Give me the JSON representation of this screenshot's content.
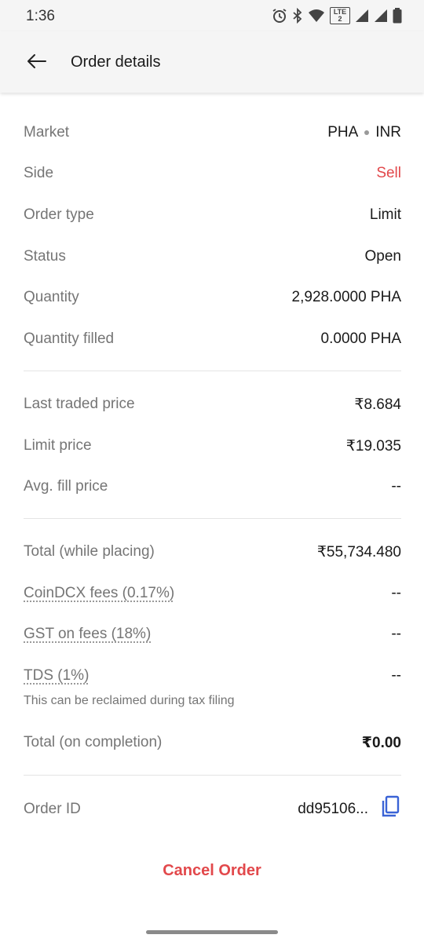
{
  "status_bar": {
    "time": "1:36",
    "network_badge": "LTE 2"
  },
  "header": {
    "title": "Order details"
  },
  "details": {
    "market_label": "Market",
    "market_base": "PHA",
    "market_quote": "INR",
    "side_label": "Side",
    "side_value": "Sell",
    "order_type_label": "Order type",
    "order_type_value": "Limit",
    "status_label": "Status",
    "status_value": "Open",
    "quantity_label": "Quantity",
    "quantity_value": "2,928.0000 PHA",
    "quantity_filled_label": "Quantity filled",
    "quantity_filled_value": "0.0000 PHA"
  },
  "prices": {
    "last_traded_label": "Last traded price",
    "last_traded_value": "₹8.684",
    "limit_label": "Limit price",
    "limit_value": "₹19.035",
    "avg_fill_label": "Avg. fill price",
    "avg_fill_value": "--"
  },
  "totals": {
    "total_placing_label": "Total (while placing)",
    "total_placing_value": "₹55,734.480",
    "fees_label": "CoinDCX fees (0.17%)",
    "fees_value": "--",
    "gst_label": "GST on fees (18%)",
    "gst_value": "--",
    "tds_label": "TDS (1%)",
    "tds_value": "--",
    "tds_note": "This can be reclaimed during tax filing",
    "total_completion_label": "Total (on completion)",
    "total_completion_value": "₹0.00"
  },
  "order": {
    "id_label": "Order ID",
    "id_value": "dd95106..."
  },
  "actions": {
    "cancel_label": "Cancel Order"
  },
  "colors": {
    "sell": "#e2484b",
    "accent": "#3a63d6",
    "label": "#757575"
  },
  "icons": [
    "alarm-icon",
    "bluetooth-icon",
    "wifi-icon",
    "signal-icon",
    "battery-icon",
    "back-arrow-icon",
    "copy-icon"
  ]
}
